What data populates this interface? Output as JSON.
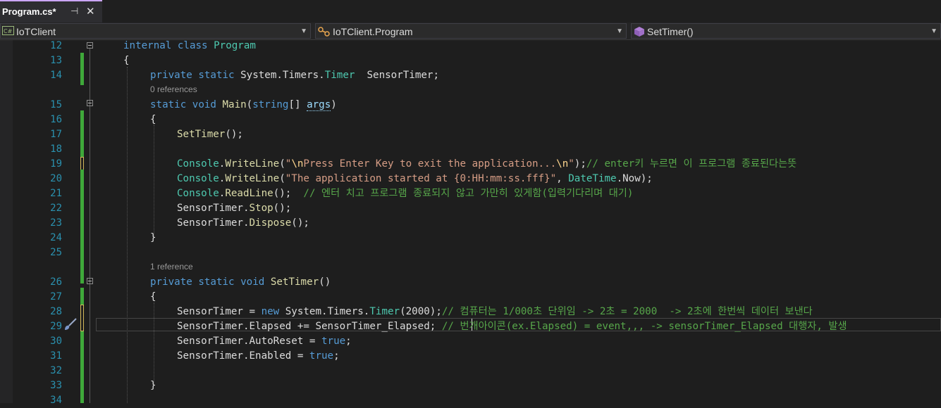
{
  "tab": {
    "title": "Program.cs*",
    "pin": "⊣",
    "close": "✕"
  },
  "nav": {
    "project": "IoTClient",
    "class": "IoTClient.Program",
    "member": "SetTimer()"
  },
  "colors": {
    "keyword": "#569cd6",
    "type": "#4ec9b0",
    "method": "#dcdcaa",
    "string": "#d69d85",
    "comment": "#57a64a",
    "linenum": "#2b91af",
    "change": "#3fa83a"
  },
  "hints": {
    "main": "0 references",
    "settimer": "1 reference"
  },
  "lines": [
    {
      "n": "12",
      "segs": [
        [
          "kw",
          "internal class "
        ],
        [
          "ty",
          "Program"
        ]
      ]
    },
    {
      "n": "13",
      "segs": [
        [
          "",
          "{"
        ]
      ]
    },
    {
      "n": "14",
      "segs": [
        [
          "kw",
          "private static "
        ],
        [
          "ns",
          "System.Timers."
        ],
        [
          "ty",
          "Timer"
        ],
        [
          "",
          "  SensorTimer;"
        ]
      ]
    },
    {
      "n": "15",
      "segs": [
        [
          "kw",
          "static void "
        ],
        [
          "mt",
          "Main"
        ],
        [
          "",
          "("
        ],
        [
          "kw",
          "string"
        ],
        [
          "",
          "[] "
        ],
        [
          "param",
          "args"
        ],
        [
          "",
          ")"
        ]
      ]
    },
    {
      "n": "16",
      "segs": [
        [
          "",
          "{"
        ]
      ]
    },
    {
      "n": "17",
      "segs": [
        [
          "mt",
          "SetTimer"
        ],
        [
          "",
          "();"
        ]
      ]
    },
    {
      "n": "18",
      "segs": [
        [
          "",
          ""
        ]
      ]
    },
    {
      "n": "19",
      "segs": [
        [
          "ty",
          "Console"
        ],
        [
          "",
          "."
        ],
        [
          "mt",
          "WriteLine"
        ],
        [
          "",
          "("
        ],
        [
          "st",
          "\""
        ],
        [
          "es",
          "\\n"
        ],
        [
          "st",
          "Press Enter Key to exit the application..."
        ],
        [
          "es",
          "\\n"
        ],
        [
          "st",
          "\""
        ],
        [
          "",
          ");"
        ],
        [
          "cm",
          "// enter키 누르면 이 프로그램 종료된다는뜻"
        ]
      ]
    },
    {
      "n": "20",
      "segs": [
        [
          "ty",
          "Console"
        ],
        [
          "",
          "."
        ],
        [
          "mt",
          "WriteLine"
        ],
        [
          "",
          "("
        ],
        [
          "st",
          "\"The application started at {0:HH:mm:ss.fff}\""
        ],
        [
          "",
          ", "
        ],
        [
          "ty",
          "DateTime"
        ],
        [
          "",
          ".Now);"
        ]
      ]
    },
    {
      "n": "21",
      "segs": [
        [
          "ty",
          "Console"
        ],
        [
          "",
          "."
        ],
        [
          "mt",
          "ReadLine"
        ],
        [
          "",
          "();  "
        ],
        [
          "cm",
          "// 엔터 치고 프로그램 종료되지 않고 가만히 있게함(입력기다리며 대기)"
        ]
      ]
    },
    {
      "n": "22",
      "segs": [
        [
          "",
          "SensorTimer."
        ],
        [
          "mt",
          "Stop"
        ],
        [
          "",
          "();"
        ]
      ]
    },
    {
      "n": "23",
      "segs": [
        [
          "",
          "SensorTimer."
        ],
        [
          "mt",
          "Dispose"
        ],
        [
          "",
          "();"
        ]
      ]
    },
    {
      "n": "24",
      "segs": [
        [
          "",
          "}"
        ]
      ]
    },
    {
      "n": "25",
      "segs": [
        [
          "",
          ""
        ]
      ]
    },
    {
      "n": "26",
      "segs": [
        [
          "kw",
          "private static void "
        ],
        [
          "mt",
          "SetTimer"
        ],
        [
          "",
          "()"
        ]
      ]
    },
    {
      "n": "27",
      "segs": [
        [
          "",
          "{"
        ]
      ]
    },
    {
      "n": "28",
      "segs": [
        [
          "",
          "SensorTimer = "
        ],
        [
          "kw",
          "new "
        ],
        [
          "ns",
          "System.Timers."
        ],
        [
          "ty",
          "Timer"
        ],
        [
          "",
          "(2000);"
        ],
        [
          "cm",
          "// 컴퓨터는 1/000초 단위임 -> 2초 = 2000  -> 2초에 한번씩 데이터 보낸다"
        ]
      ]
    },
    {
      "n": "29",
      "segs": [
        [
          "",
          "SensorTimer.Elapsed += SensorTimer_Elapsed; "
        ],
        [
          "cm",
          "// 번개아이콘(ex.Elapsed) = event,,, -> sensorTimer_Elapsed 대행자, 발생"
        ]
      ]
    },
    {
      "n": "30",
      "segs": [
        [
          "",
          "SensorTimer.AutoReset = "
        ],
        [
          "kw",
          "true"
        ],
        [
          "",
          ";"
        ]
      ]
    },
    {
      "n": "31",
      "segs": [
        [
          "",
          "SensorTimer.Enabled = "
        ],
        [
          "kw",
          "true"
        ],
        [
          "",
          ";"
        ]
      ]
    },
    {
      "n": "32",
      "segs": [
        [
          "",
          ""
        ]
      ]
    },
    {
      "n": "33",
      "segs": [
        [
          "",
          "}"
        ]
      ]
    },
    {
      "n": "34",
      "segs": [
        [
          "",
          ""
        ]
      ]
    }
  ]
}
